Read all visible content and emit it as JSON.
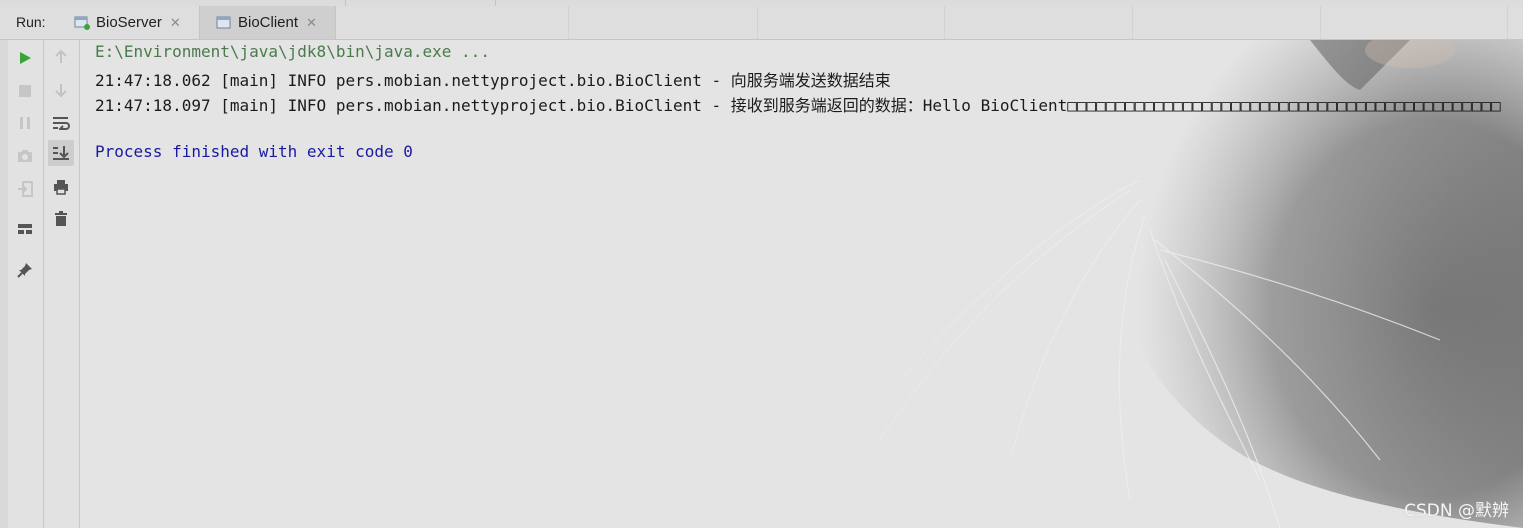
{
  "run_panel": {
    "label": "Run:",
    "tabs": [
      {
        "label": "BioServer",
        "active": false
      },
      {
        "label": "BioClient",
        "active": true
      }
    ]
  },
  "toolbar_left": [
    {
      "name": "rerun-icon",
      "enabled": true
    },
    {
      "name": "stop-icon",
      "enabled": false
    },
    {
      "name": "pause-icon",
      "enabled": false
    },
    {
      "name": "camera-icon",
      "enabled": false
    },
    {
      "name": "login-icon",
      "enabled": false
    },
    {
      "name": "layout-icon",
      "enabled": true
    },
    {
      "name": "pin-icon",
      "enabled": true
    }
  ],
  "toolbar_right": [
    {
      "name": "up-arrow-icon",
      "enabled": false
    },
    {
      "name": "down-arrow-icon",
      "enabled": false
    },
    {
      "name": "soft-wrap-icon",
      "enabled": true
    },
    {
      "name": "scroll-to-end-icon",
      "enabled": true,
      "selected": true
    },
    {
      "name": "print-icon",
      "enabled": true
    },
    {
      "name": "trash-icon",
      "enabled": true
    }
  ],
  "console": {
    "command": "E:\\Environment\\java\\jdk8\\bin\\java.exe ...",
    "log_lines": [
      "21:47:18.062 [main] INFO pers.mobian.nettyproject.bio.BioClient - 向服务端发送数据结束",
      "21:47:18.097 [main] INFO pers.mobian.nettyproject.bio.BioClient - 接收到服务端返回的数据：Hello BioClient□□□□□□□□□□□□□□□□□□□□□□□□□□□□□□□□□□□□□□□□□□□□□"
    ],
    "exit_message": "Process finished with exit code 0"
  },
  "watermark": "CSDN @默辨",
  "colors": {
    "command_text": "#4b7a4b",
    "exit_text": "#1a1aa0",
    "run_green": "#3aa33a"
  }
}
